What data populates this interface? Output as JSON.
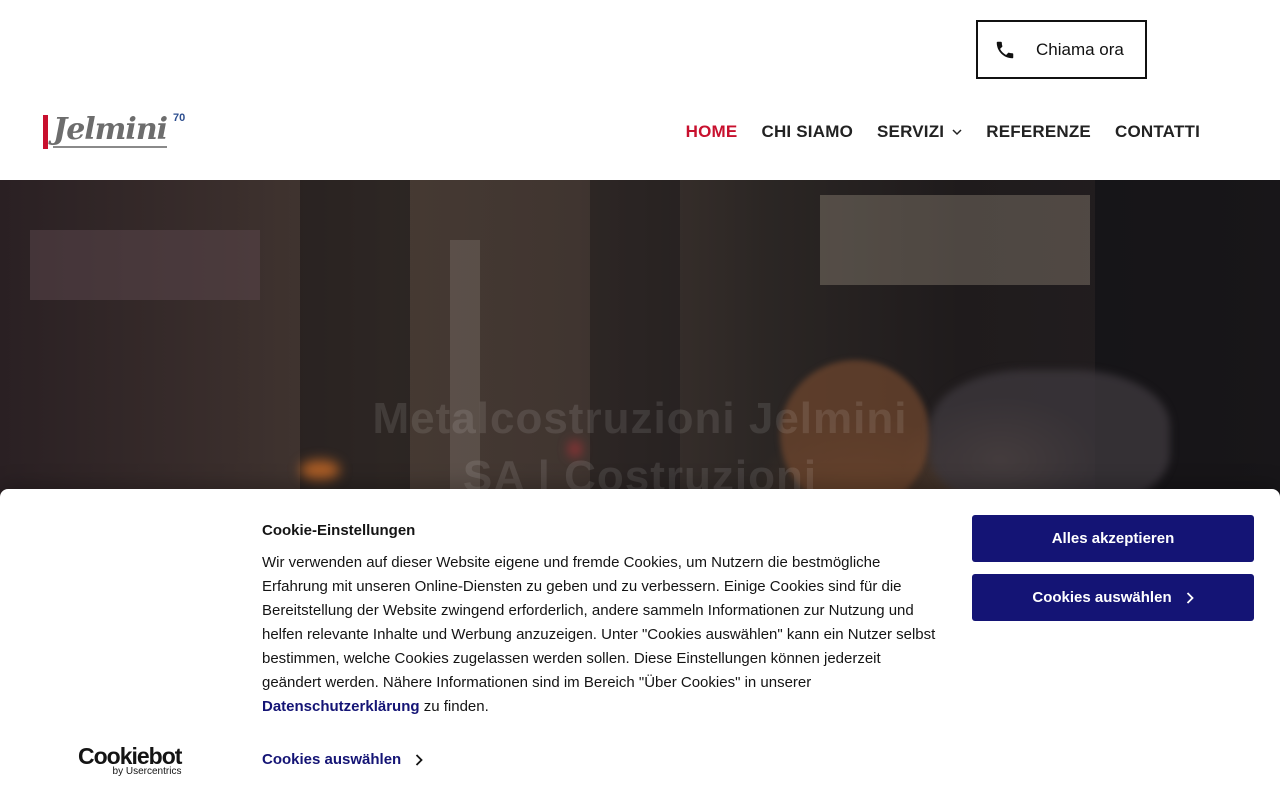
{
  "header": {
    "call_label": "Chiama ora",
    "logo_text": "Jelmini",
    "logo_badge": "70",
    "nav": [
      {
        "label": "HOME",
        "active": true
      },
      {
        "label": "CHI SIAMO",
        "active": false
      },
      {
        "label": "SERVIZI",
        "active": false,
        "has_dropdown": true
      },
      {
        "label": "REFERENZE",
        "active": false
      },
      {
        "label": "CONTATTI",
        "active": false
      }
    ]
  },
  "hero": {
    "title_line1": "Metalcostruzioni Jelmini",
    "title_line2": "SA | Costruzioni"
  },
  "cookie": {
    "title": "Cookie-Einstellungen",
    "body_before_link": "Wir verwenden auf dieser Website eigene und fremde Cookies, um Nutzern die bestmögliche Erfahrung mit unseren Online-Diensten zu geben und zu verbessern. Einige Cookies sind für die Bereitstellung der Website zwingend erforderlich, andere sammeln Informationen zur Nutzung und helfen relevante Inhalte und Werbung anzuzeigen. Unter \"Cookies auswählen\" kann ein Nutzer selbst bestimmen, welche Cookies zugelassen werden sollen. Diese Einstellungen können jederzeit geändert werden. Nähere Informationen sind im Bereich \"Über Cookies\" in unserer ",
    "link_text": "Datenschutzerklärung",
    "body_after_link": " zu finden.",
    "accept_all": "Alles akzeptieren",
    "select_cookies": "Cookies auswählen",
    "select_link": "Cookies auswählen",
    "brand_name": "Cookiebot",
    "brand_by": "by Usercentrics"
  },
  "colors": {
    "accent": "#c8102e",
    "cookie_button": "#141475"
  },
  "icons": [
    "phone-icon",
    "chevron-down-icon",
    "chevron-right-icon"
  ]
}
